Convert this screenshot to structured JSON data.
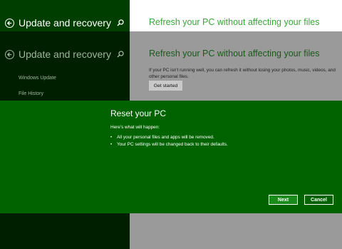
{
  "top": {
    "back_label": "Update and recovery",
    "page_title": "Refresh your PC without affecting your files"
  },
  "background": {
    "back_label": "Update and recovery",
    "nav_items": [
      "Windows Update",
      "File History"
    ],
    "page_title": "Refresh your PC without affecting your files",
    "description": "If your PC isn't running well, you can refresh it without losing your photos, music, videos, and other personal files.",
    "get_started": "Get started"
  },
  "dialog": {
    "title": "Reset your PC",
    "subtitle": "Here's what will happen:",
    "items": [
      "All your personal files and apps will be removed.",
      "Your PC settings will be changed back to their defaults."
    ],
    "next": "Next",
    "cancel": "Cancel"
  },
  "colors": {
    "accent_green": "#006300",
    "title_green": "#3aa63a",
    "sidebar_dark": "#003e00"
  }
}
